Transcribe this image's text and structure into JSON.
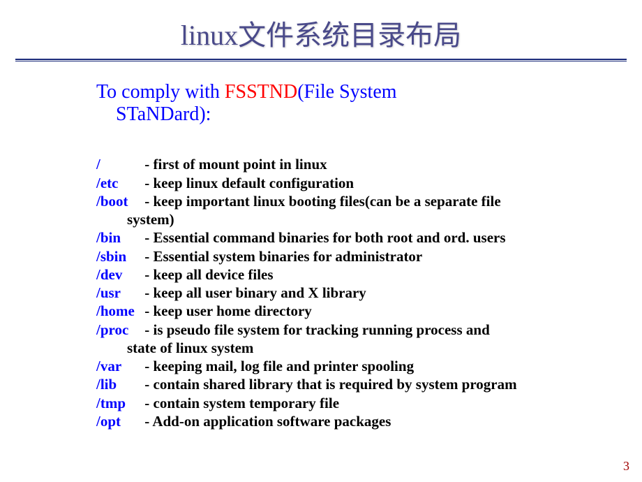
{
  "title": "linux文件系统目录布局",
  "intro": {
    "prefix": "To comply with ",
    "red": "FSSTND",
    "suffix": "(File System",
    "line2": "STaNDard):"
  },
  "dirs": [
    {
      "path": "/",
      "desc": "- first of mount point in linux"
    },
    {
      "path": "/etc",
      "desc": "- keep linux default configuration"
    },
    {
      "path": "/boot",
      "desc": "- keep important linux booting files(can be a separate file",
      "cont": "system)"
    },
    {
      "path": "/bin",
      "desc": "- Essential command binaries for both root and ord. users"
    },
    {
      "path": "/sbin",
      "desc": "- Essential system binaries for administrator"
    },
    {
      "path": "/dev",
      "desc": "- keep all device files"
    },
    {
      "path": "/usr",
      "desc": "- keep all user binary and X library"
    },
    {
      "path": "/home",
      "desc": "- keep user home directory"
    },
    {
      "path": "/proc",
      "desc": "- is pseudo file system for tracking running process and",
      "cont": "state of linux system"
    },
    {
      "path": "/var",
      "desc": "- keeping mail, log file and printer spooling"
    },
    {
      "path": "/lib",
      "desc": "- contain shared library that is required by system program"
    },
    {
      "path": "/tmp",
      "desc": "- contain system temporary file"
    },
    {
      "path": "/opt",
      "desc": "- Add-on application software packages"
    }
  ],
  "pageNumber": "3"
}
